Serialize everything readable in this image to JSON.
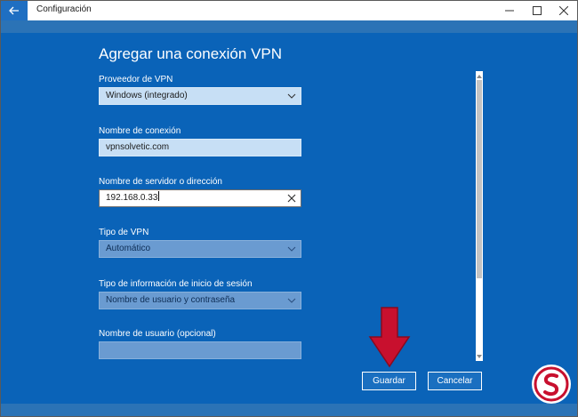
{
  "window": {
    "title": "Configuración"
  },
  "form": {
    "heading": "Agregar una conexión VPN",
    "provider": {
      "label": "Proveedor de VPN",
      "value": "Windows (integrado)"
    },
    "connection_name": {
      "label": "Nombre de conexión",
      "value": "vpnsolvetic.com"
    },
    "server": {
      "label": "Nombre de servidor o dirección",
      "value": "192.168.0.33"
    },
    "vpn_type": {
      "label": "Tipo de VPN",
      "value": "Automático"
    },
    "signin_type": {
      "label": "Tipo de información de inicio de sesión",
      "value": "Nombre de usuario y contraseña"
    },
    "username": {
      "label": "Nombre de usuario (opcional)",
      "value": ""
    }
  },
  "buttons": {
    "save": "Guardar",
    "cancel": "Cancelar"
  },
  "colors": {
    "accent": "#0a63b8",
    "arrow": "#c8102e"
  },
  "icons": {
    "back": "back-arrow-icon",
    "minimize": "minimize-icon",
    "maximize": "maximize-icon",
    "close": "close-icon",
    "dropdown": "chevron-down-icon",
    "clear": "clear-x-icon"
  }
}
